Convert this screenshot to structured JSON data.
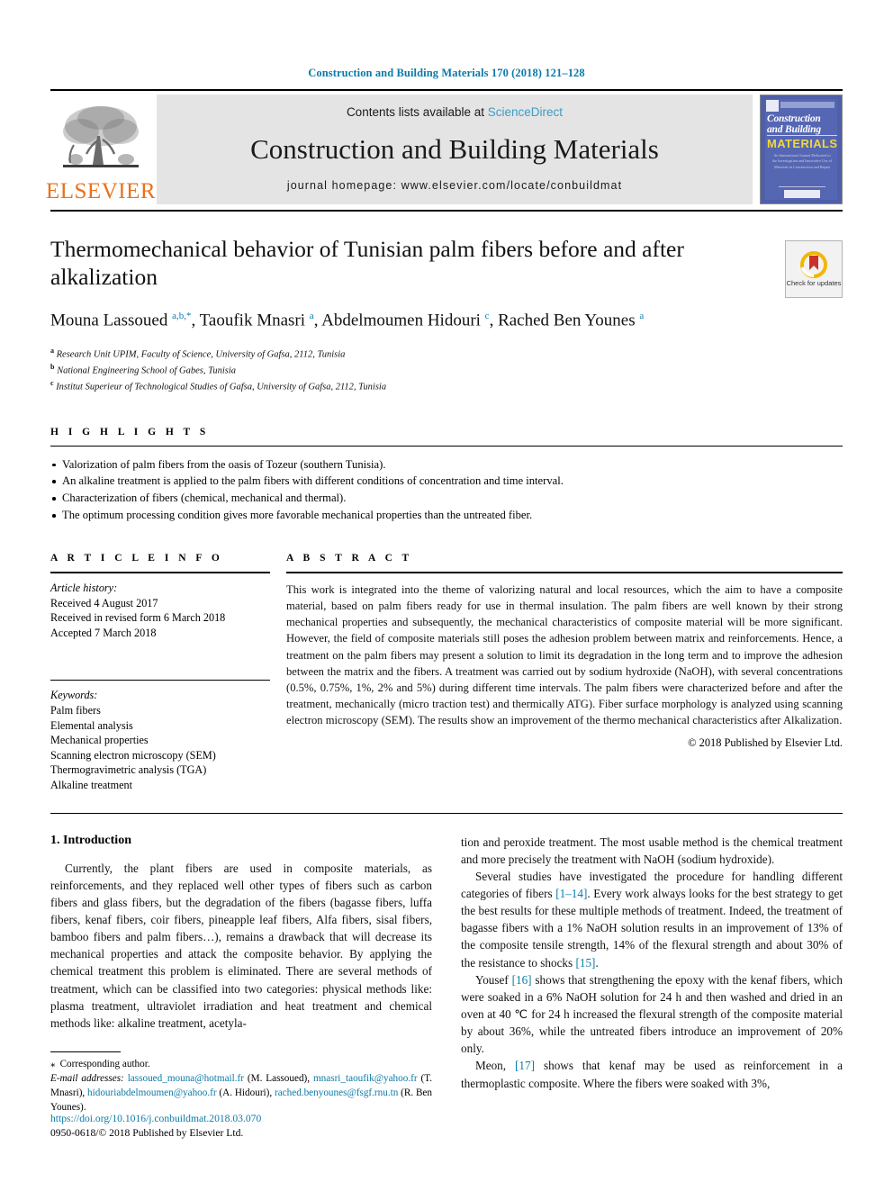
{
  "running_head": "Construction and Building Materials 170 (2018) 121–128",
  "masthead": {
    "publisher": "ELSEVIER",
    "contents_prefix": "Contents lists available at ",
    "contents_link": "ScienceDirect",
    "journal_name": "Construction and Building Materials",
    "homepage": "journal homepage: www.elsevier.com/locate/conbuildmat",
    "cover": {
      "line1": "Construction",
      "line2": "and Building",
      "line3": "MATERIALS",
      "blurb": "An International Journal Dedicated to the Investigation and Innovative Use of Materials in Construction and Repair"
    }
  },
  "article": {
    "title": "Thermomechanical behavior of Tunisian palm fibers before and after alkalization",
    "authors_html": "Mouna Lassoued <sup>a,b,</sup><sup>*</sup>, Taoufik Mnasri <sup>a</sup>, Abdelmoumen Hidouri <sup>c</sup>, Rached Ben Younes <sup>a</sup>",
    "crossmark_label": "Check for updates",
    "affiliations": [
      {
        "mark": "a",
        "text": "Research Unit UPIM, Faculty of Science, University of Gafsa, 2112, Tunisia"
      },
      {
        "mark": "b",
        "text": "National Engineering School of Gabes, Tunisia"
      },
      {
        "mark": "c",
        "text": "Institut Superieur of Technological Studies of Gafsa, University of Gafsa, 2112, Tunisia"
      }
    ]
  },
  "highlights": {
    "heading": "H I G H L I G H T S",
    "items": [
      "Valorization of palm fibers from the oasis of Tozeur (southern Tunisia).",
      "An alkaline treatment is applied to the palm fibers with different conditions of concentration and time interval.",
      "Characterization of fibers (chemical, mechanical and thermal).",
      "The optimum processing condition gives more favorable mechanical properties than the untreated fiber."
    ]
  },
  "article_info": {
    "heading": "A R T I C L E    I N F O",
    "history_label": "Article history:",
    "history": [
      "Received 4 August 2017",
      "Received in revised form 6 March 2018",
      "Accepted 7 March 2018"
    ],
    "keywords_label": "Keywords:",
    "keywords": [
      "Palm fibers",
      "Elemental analysis",
      "Mechanical properties",
      "Scanning electron microscopy (SEM)",
      "Thermogravimetric analysis (TGA)",
      "Alkaline treatment"
    ]
  },
  "abstract": {
    "heading": "A B S T R A C T",
    "text": "This work is integrated into the theme of valorizing natural and local resources, which the aim to have a composite material, based on palm fibers ready for use in thermal insulation. The palm fibers are well known by their strong mechanical properties and subsequently, the mechanical characteristics of composite material will be more significant. However, the field of composite materials still poses the adhesion problem between matrix and reinforcements. Hence, a treatment on the palm fibers may present a solution to limit its degradation in the long term and to improve the adhesion between the matrix and the fibers. A treatment was carried out by sodium hydroxide (NaOH), with several concentrations (0.5%, 0.75%, 1%, 2% and 5%) during different time intervals. The palm fibers were characterized before and after the treatment, mechanically (micro traction test) and thermically ATG). Fiber surface morphology is analyzed using scanning electron microscopy (SEM). The results show an improvement of the thermo mechanical characteristics after Alkalization.",
    "copyright": "© 2018 Published by Elsevier Ltd."
  },
  "body": {
    "section_number_title": "1. Introduction",
    "left_paragraphs": [
      "Currently, the plant fibers are used in composite materials, as reinforcements, and they replaced well other types of fibers such as carbon fibers and glass fibers, but the degradation of the fibers (bagasse fibers, luffa fibers, kenaf fibers, coir fibers, pineapple leaf fibers, Alfa fibers, sisal fibers, bamboo fibers and palm fibers…), remains a drawback that will decrease its mechanical properties and attack the composite behavior. By applying the chemical treatment this problem is eliminated. There are several methods of treatment, which can be classified into two categories: physical methods like: plasma treatment, ultraviolet irradiation and heat treatment and chemical methods like: alkaline treatment, acetyla-"
    ],
    "right_paragraphs": [
      {
        "indent": false,
        "html": "tion and peroxide treatment. The most usable method is the chemical treatment and more precisely the treatment with NaOH (sodium hydroxide)."
      },
      {
        "indent": true,
        "html": "Several studies have investigated the procedure for handling different categories of fibers <span class=\"ref\">[1–14]</span>. Every work always looks for the best strategy to get the best results for these multiple methods of treatment. Indeed, the treatment of bagasse fibers with a 1% NaOH solution results in an improvement of 13% of the composite tensile strength, 14% of the flexural strength and about 30% of the resistance to shocks <span class=\"ref\">[15]</span>."
      },
      {
        "indent": true,
        "html": "Yousef <span class=\"ref\">[16]</span> shows that strengthening the epoxy with the kenaf fibers, which were soaked in a 6% NaOH solution for 24 h and then washed and dried in an oven at 40 ℃ for 24 h increased the flexural strength of the composite material by about 36%, while the untreated fibers introduce an improvement of 20% only."
      },
      {
        "indent": true,
        "html": "Meon, <span class=\"ref\">[17]</span> shows that kenaf may be used as reinforcement in a thermoplastic composite. Where the fibers were soaked with 3%,"
      }
    ]
  },
  "footnote": {
    "corresponding": "Corresponding author.",
    "email_label": "E-mail addresses:",
    "emails_html": "<a class=\"mail\" data-name=\"email-link-lassoued\" data-interactable=\"true\">lassoued_mouna@hotmail.fr</a> (M. Lassoued), <a class=\"mail\" data-name=\"email-link-mnasri\" data-interactable=\"true\">mnasri_taoufik@yahoo.fr</a> (T. Mnasri), <a class=\"mail\" data-name=\"email-link-hidouri\" data-interactable=\"true\">hidouriabdelmoumen@yahoo.fr</a> (A. Hidouri), <a class=\"mail\" data-name=\"email-link-benyounes\" data-interactable=\"true\">rached.benyounes@fsgf.rnu.tn</a> (R. Ben Younes)."
  },
  "footer": {
    "doi": "https://doi.org/10.1016/j.conbuildmat.2018.03.070",
    "issn_line": "0950-0618/© 2018 Published by Elsevier Ltd."
  },
  "colors": {
    "link": "#0c7aa8",
    "sciencedirect": "#3d9cc9",
    "elsevier_orange": "#E9711C",
    "band_gray": "#e4e4e4",
    "cover_blue": "#5566b3",
    "cover_yellow": "#f2d73b"
  }
}
